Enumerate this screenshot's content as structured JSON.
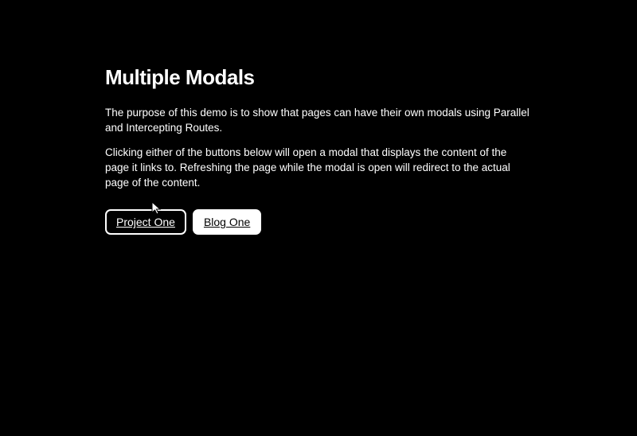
{
  "header": {
    "title": "Multiple Modals"
  },
  "content": {
    "paragraph1": "The purpose of this demo is to show that pages can have their own modals using Parallel and Intercepting Routes.",
    "paragraph2": "Clicking either of the buttons below will open a modal that displays the content of the page it links to. Refreshing the page while the modal is open will redirect to the actual page of the content."
  },
  "buttons": {
    "project": "Project One",
    "blog": "Blog One"
  }
}
